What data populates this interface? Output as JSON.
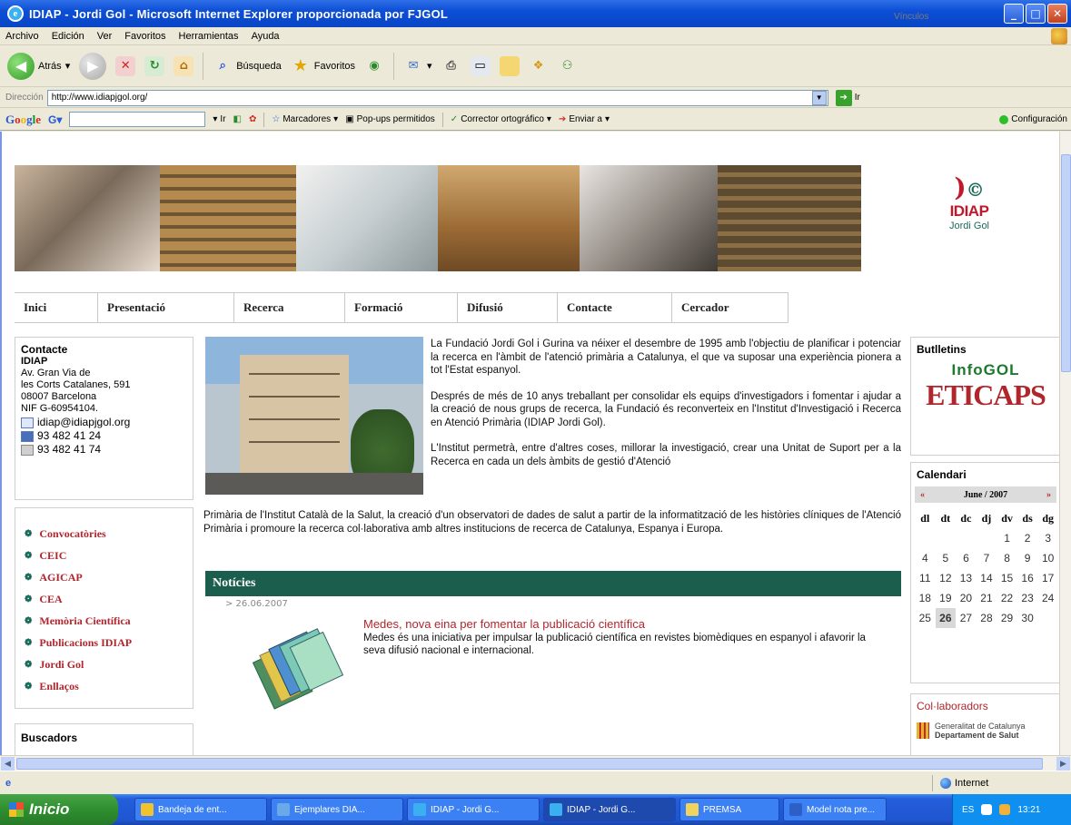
{
  "window": {
    "title": "IDIAP - Jordi Gol - Microsoft Internet Explorer proporcionada por FJGOL"
  },
  "menu": [
    "Archivo",
    "Edición",
    "Ver",
    "Favoritos",
    "Herramientas",
    "Ayuda"
  ],
  "toolbar": {
    "back_label": "Atrás",
    "search_label": "Búsqueda",
    "favorites_label": "Favoritos"
  },
  "address": {
    "label": "Dirección",
    "url": "http://www.idiapjgol.org/",
    "go_label": "Ir",
    "links_label": "Vínculos"
  },
  "google_bar": {
    "logo": [
      "G",
      "o",
      "o",
      "g",
      "l",
      "e"
    ],
    "go_label": "Ir",
    "bookmarks_label": "Marcadores",
    "popups_label": "Pop-ups permitidos",
    "spell_label": "Corrector ortográfico",
    "send_label": "Enviar a",
    "config_label": "Configuración"
  },
  "logo": {
    "name": "IDIAP",
    "sub": "Jordi Gol"
  },
  "nav": [
    {
      "label": "Inici",
      "w": 92
    },
    {
      "label": "Presentació",
      "w": 150
    },
    {
      "label": "Recerca",
      "w": 122
    },
    {
      "label": "Formació",
      "w": 124
    },
    {
      "label": "Difusió",
      "w": 110
    },
    {
      "label": "Contacte",
      "w": 126
    },
    {
      "label": "Cercador",
      "w": 128
    }
  ],
  "contact": {
    "title": "Contacte",
    "org": "IDIAP",
    "addr1": "Av. Gran Via de",
    "addr2": "les Corts Catalanes, 591",
    "addr3": "08007 Barcelona",
    "nif": "NIF G-60954104.",
    "email": "idiap@idiapjgol.org",
    "phone": "93 482 41 24",
    "fax": "93 482 41 74"
  },
  "left_links": [
    "Convocatòries",
    "CEIC",
    "AGICAP",
    "CEA",
    "Memòria Científica",
    "Publicacions IDIAP",
    "Jordi Gol",
    "Enllaços"
  ],
  "buscadors_title": "Buscadors",
  "intro": {
    "p1": "La Fundació Jordi Gol i Gurina va néixer el desembre de 1995 amb l'objectiu de planificar i potenciar la recerca en l'àmbit de l'atenció primària a Catalunya, el que va suposar una experiència pionera a tot l'Estat espanyol.",
    "p2": "Després de més de 10 anys treballant per consolidar els equips d'investigadors i fomentar i ajudar a la creació de nous grups de recerca, la Fundació és reconverteix en l'Institut d'Investigació i Recerca en Atenció Primària (IDIAP Jordi Gol).",
    "p3a": "L'Institut permetrà, entre d'altres coses, millorar la investigació, crear una Unitat de Suport per a la Recerca en cada un dels àmbits de gestió d'Atenció",
    "p3b": "Primària de l'Institut Català de la Salut, la creació d'un observatori de dades de salut a partir de la informatització de les històries clíniques de l'Atenció Primària i promoure la recerca col·laborativa amb altres institucions de recerca de Catalunya, Espanya i Europa."
  },
  "news": {
    "header": "Notícies",
    "date": "> 26.06.2007",
    "title": "Medes, nova eina per fomentar la publicació científica",
    "body": "Medes és una iniciativa per impulsar la publicació científica en revistes biomèdiques en espanyol i afavorir la seva difusió nacional e internacional."
  },
  "butlletins": {
    "title": "Butlletins",
    "infogol": "InfoGOL",
    "eticaps": "ETICAPS"
  },
  "calendar": {
    "title": "Calendari",
    "month": "June / 2007",
    "prev": "«",
    "next": "»",
    "weekdays": [
      "dl",
      "dt",
      "dc",
      "dj",
      "dv",
      "ds",
      "dg"
    ],
    "weeks": [
      [
        "",
        "",
        "",
        "",
        "1",
        "2",
        "3"
      ],
      [
        "4",
        "5",
        "6",
        "7",
        "8",
        "9",
        "10"
      ],
      [
        "11",
        "12",
        "13",
        "14",
        "15",
        "16",
        "17"
      ],
      [
        "18",
        "19",
        "20",
        "21",
        "22",
        "23",
        "24"
      ],
      [
        "25",
        "26",
        "27",
        "28",
        "29",
        "30",
        ""
      ]
    ],
    "today": "26"
  },
  "collaborators": {
    "title": "Col·laboradors",
    "gen1": "Generalitat de Catalunya",
    "gen2": "Departament de Salut"
  },
  "status": {
    "zone": "Internet"
  },
  "taskbar": {
    "start": "Inicio",
    "tasks": [
      {
        "label": "Bandeja de ent...",
        "color": "#f2c12e"
      },
      {
        "label": "Ejemplares DIA...",
        "color": "#6aa9e8"
      },
      {
        "label": "IDIAP - Jordi G...",
        "color": "#3ab0f0"
      },
      {
        "label": "IDIAP - Jordi G...",
        "color": "#3ab0f0"
      },
      {
        "label": "PREMSA",
        "color": "#f2d35c"
      },
      {
        "label": "Model nota pre...",
        "color": "#2d5fc7"
      }
    ],
    "lang": "ES",
    "clock": "13:21"
  }
}
